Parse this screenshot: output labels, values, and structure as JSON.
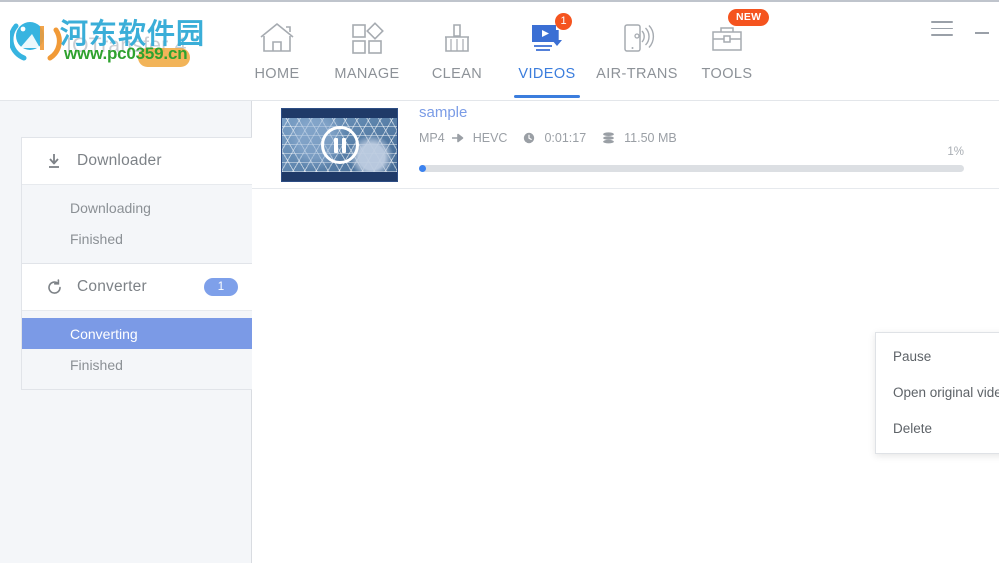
{
  "window": {
    "logo_text": "IOTransfer 4",
    "watermark_cn": "河东软件园",
    "watermark_url": "www.pc0359.cn",
    "menu_icon": "hamburger-menu-icon",
    "minimize_icon": "minimize-icon"
  },
  "nav": {
    "items": [
      {
        "label": "HOME",
        "icon": "home-icon",
        "active": false,
        "badge": ""
      },
      {
        "label": "MANAGE",
        "icon": "manage-icon",
        "active": false,
        "badge": ""
      },
      {
        "label": "CLEAN",
        "icon": "broom-icon",
        "active": false,
        "badge": ""
      },
      {
        "label": "VIDEOS",
        "icon": "video-download-icon",
        "active": true,
        "badge": "1"
      },
      {
        "label": "AIR-TRANS",
        "icon": "phone-wifi-icon",
        "active": false,
        "badge": ""
      },
      {
        "label": "TOOLS",
        "icon": "toolbox-icon",
        "active": false,
        "badge": "NEW"
      }
    ],
    "active_color": "#3b7ddd",
    "badge_color": "#f5541f"
  },
  "sidebar": {
    "groups": [
      {
        "title": "Downloader",
        "icon": "download-icon",
        "badge": "",
        "items": [
          {
            "label": "Downloading",
            "active": false
          },
          {
            "label": "Finished",
            "active": false
          }
        ]
      },
      {
        "title": "Converter",
        "icon": "refresh-icon",
        "badge": "1",
        "items": [
          {
            "label": "Converting",
            "active": true
          },
          {
            "label": "Finished",
            "active": false
          }
        ]
      }
    ],
    "active_color": "#7b9ae6",
    "badge_color": "#7ea0ea"
  },
  "video": {
    "title": "sample",
    "source_format": "MP4",
    "arrow": "➡",
    "target_format": "HEVC",
    "duration_icon": "clock-icon",
    "duration": "0:01:17",
    "size_icon": "disk-stack-icon",
    "size": "11.50 MB",
    "progress_label": "1%",
    "progress_value": 1,
    "thumbnail_state": "pause-button-overlay"
  },
  "context_menu": {
    "items": [
      {
        "label": "Pause"
      },
      {
        "label": "Open original video location"
      },
      {
        "label": "Delete"
      }
    ]
  }
}
